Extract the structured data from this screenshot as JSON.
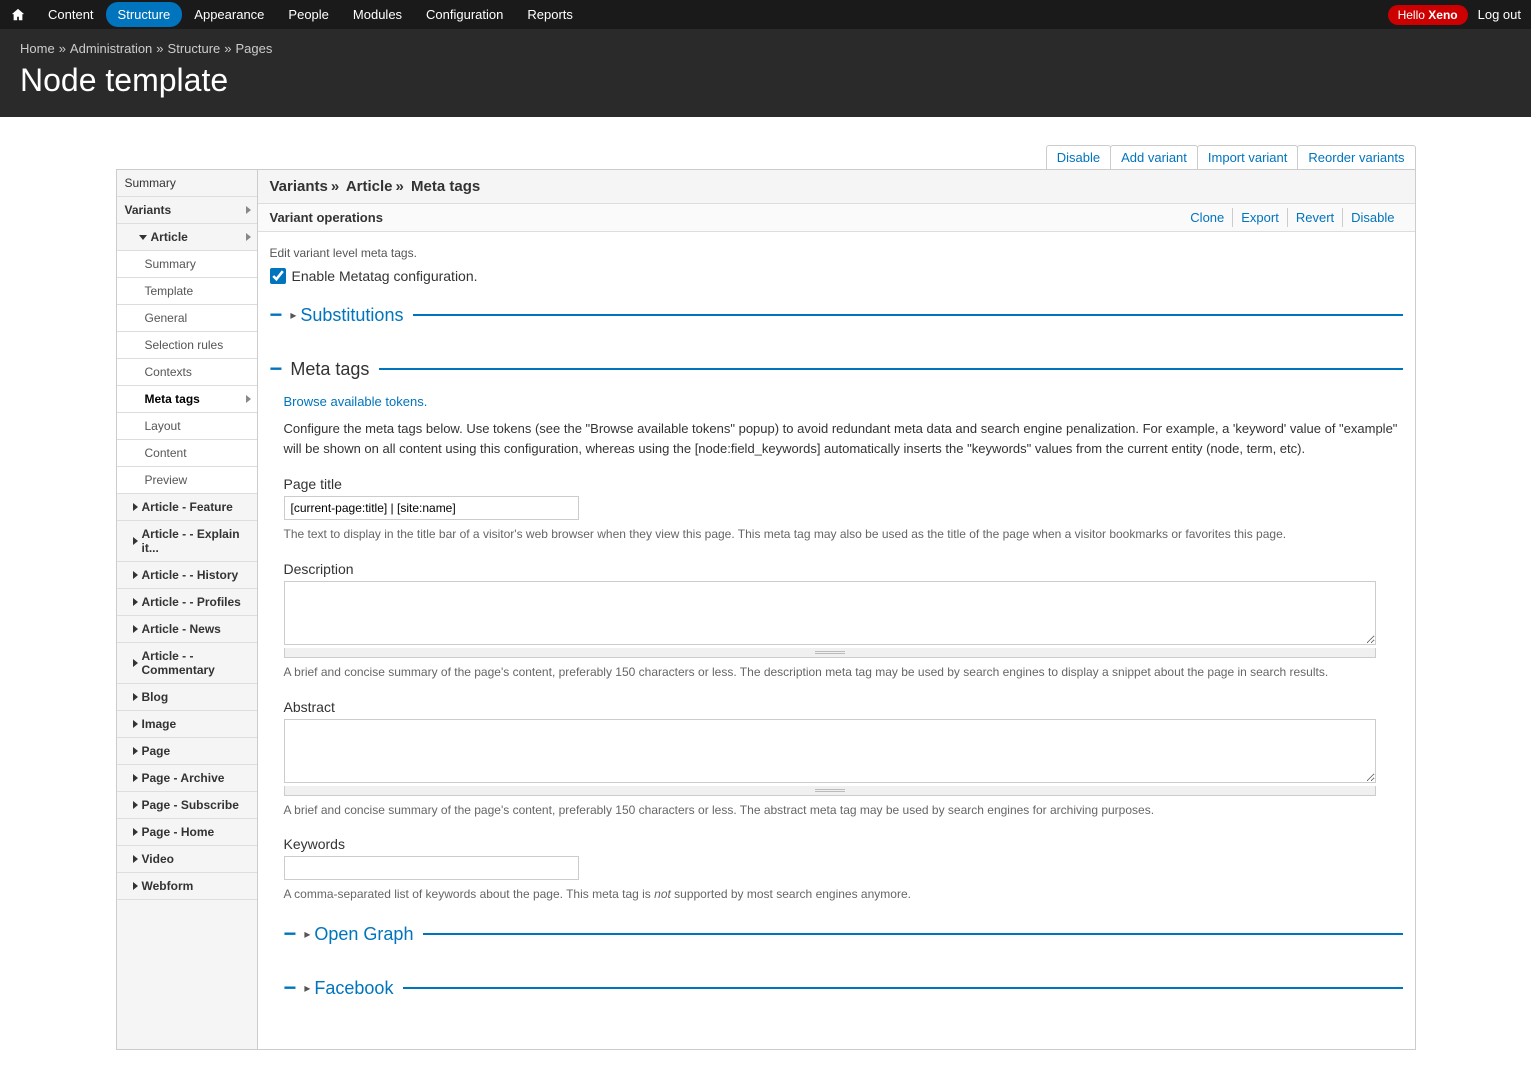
{
  "toolbar": {
    "items": [
      "Content",
      "Structure",
      "Appearance",
      "People",
      "Modules",
      "Configuration",
      "Reports"
    ],
    "active_index": 1,
    "hello_prefix": "Hello ",
    "hello_name": "Xeno",
    "logout": "Log out"
  },
  "breadcrumb": [
    "Home",
    "Administration",
    "Structure",
    "Pages"
  ],
  "page_title": "Node template",
  "page_tabs": [
    "Disable",
    "Add variant",
    "Import variant",
    "Reorder variants"
  ],
  "sidebar": {
    "summary": "Summary",
    "variants_label": "Variants",
    "article_label": "Article",
    "article_subs": [
      "Summary",
      "Template",
      "General",
      "Selection rules",
      "Contexts",
      "Meta tags",
      "Layout",
      "Content",
      "Preview"
    ],
    "active_sub_index": 5,
    "variants": [
      "Article - Feature",
      "Article - - Explain it...",
      "Article - - History",
      "Article - - Profiles",
      "Article - News",
      "Article - - Commentary",
      "Blog",
      "Image",
      "Page",
      "Page - Archive",
      "Page - Subscribe",
      "Page - Home",
      "Video",
      "Webform"
    ]
  },
  "content_header": {
    "parts": [
      "Variants",
      "Article",
      "Meta tags"
    ]
  },
  "variant_ops": {
    "title": "Variant operations",
    "links": [
      "Clone",
      "Export",
      "Revert",
      "Disable"
    ]
  },
  "body": {
    "edit_text": "Edit variant level meta tags.",
    "enable_label": "Enable Metatag configuration.",
    "substitutions_label": "Substitutions",
    "meta_tags_label": "Meta tags",
    "browse_tokens": "Browse available tokens.",
    "config_text": "Configure the meta tags below. Use tokens (see the \"Browse available tokens\" popup) to avoid redundant meta data and search engine penalization. For example, a 'keyword' value of \"example\" will be shown on all content using this configuration, whereas using the [node:field_keywords] automatically inserts the \"keywords\" values from the current entity (node, term, etc).",
    "page_title": {
      "label": "Page title",
      "value": "[current-page:title] | [site:name]",
      "desc": "The text to display in the title bar of a visitor's web browser when they view this page. This meta tag may also be used as the title of the page when a visitor bookmarks or favorites this page."
    },
    "description": {
      "label": "Description",
      "desc": "A brief and concise summary of the page's content, preferably 150 characters or less. The description meta tag may be used by search engines to display a snippet about the page in search results."
    },
    "abstract": {
      "label": "Abstract",
      "desc": "A brief and concise summary of the page's content, preferably 150 characters or less. The abstract meta tag may be used by search engines for archiving purposes."
    },
    "keywords": {
      "label": "Keywords",
      "desc_1": "A comma-separated list of keywords about the page. This meta tag is ",
      "desc_em": "not",
      "desc_2": " supported by most search engines anymore."
    },
    "open_graph_label": "Open Graph",
    "facebook_label": "Facebook"
  }
}
